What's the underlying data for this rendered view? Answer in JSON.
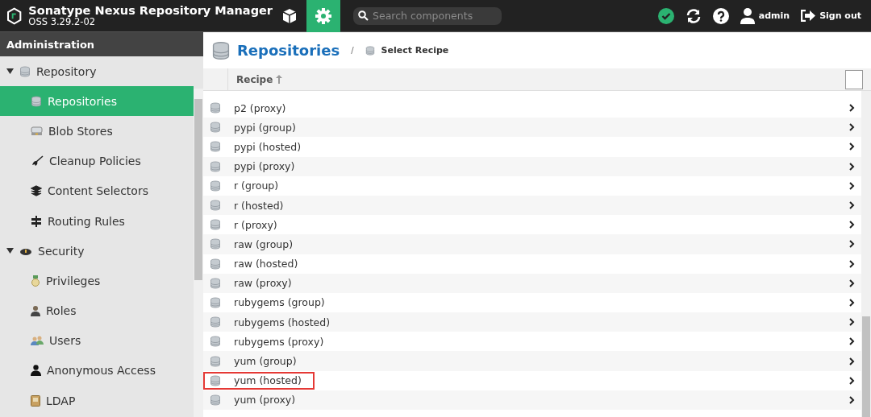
{
  "header": {
    "title": "Sonatype Nexus Repository Manager",
    "version": "OSS 3.29.2-02",
    "nav": [
      {
        "kind": "browse",
        "selected": false
      },
      {
        "kind": "admin",
        "selected": true
      }
    ],
    "search": {
      "placeholder": "Search components"
    },
    "user": "admin",
    "sign_out": "Sign out"
  },
  "sidebar": {
    "title": "Administration",
    "items": [
      {
        "label": "Repository",
        "expanded": true,
        "selected": false,
        "children": [
          {
            "label": "Repositories",
            "selected": true
          },
          {
            "label": "Blob Stores",
            "selected": false
          },
          {
            "label": "Cleanup Policies",
            "selected": false
          },
          {
            "label": "Content Selectors",
            "selected": false
          },
          {
            "label": "Routing Rules",
            "selected": false
          }
        ]
      },
      {
        "label": "Security",
        "expanded": true,
        "selected": false,
        "children": [
          {
            "label": "Privileges",
            "selected": false
          },
          {
            "label": "Roles",
            "selected": false
          },
          {
            "label": "Users",
            "selected": false
          },
          {
            "label": "Anonymous Access",
            "selected": false
          },
          {
            "label": "LDAP",
            "selected": false
          }
        ]
      }
    ]
  },
  "breadcrumb": {
    "title": "Repositories",
    "separator": "/",
    "step": "Select Recipe"
  },
  "table": {
    "columns": [
      "Recipe"
    ],
    "rows": [
      {
        "recipe": "p2 (proxy)",
        "highlighted": false
      },
      {
        "recipe": "pypi (group)",
        "highlighted": false
      },
      {
        "recipe": "pypi (hosted)",
        "highlighted": false
      },
      {
        "recipe": "pypi (proxy)",
        "highlighted": false
      },
      {
        "recipe": "r (group)",
        "highlighted": false
      },
      {
        "recipe": "r (hosted)",
        "highlighted": false
      },
      {
        "recipe": "r (proxy)",
        "highlighted": false
      },
      {
        "recipe": "raw (group)",
        "highlighted": false
      },
      {
        "recipe": "raw (hosted)",
        "highlighted": false
      },
      {
        "recipe": "raw (proxy)",
        "highlighted": false
      },
      {
        "recipe": "rubygems (group)",
        "highlighted": false
      },
      {
        "recipe": "rubygems (hosted)",
        "highlighted": false
      },
      {
        "recipe": "rubygems (proxy)",
        "highlighted": false
      },
      {
        "recipe": "yum (group)",
        "highlighted": false
      },
      {
        "recipe": "yum (hosted)",
        "highlighted": true
      },
      {
        "recipe": "yum (proxy)",
        "highlighted": false
      }
    ]
  }
}
